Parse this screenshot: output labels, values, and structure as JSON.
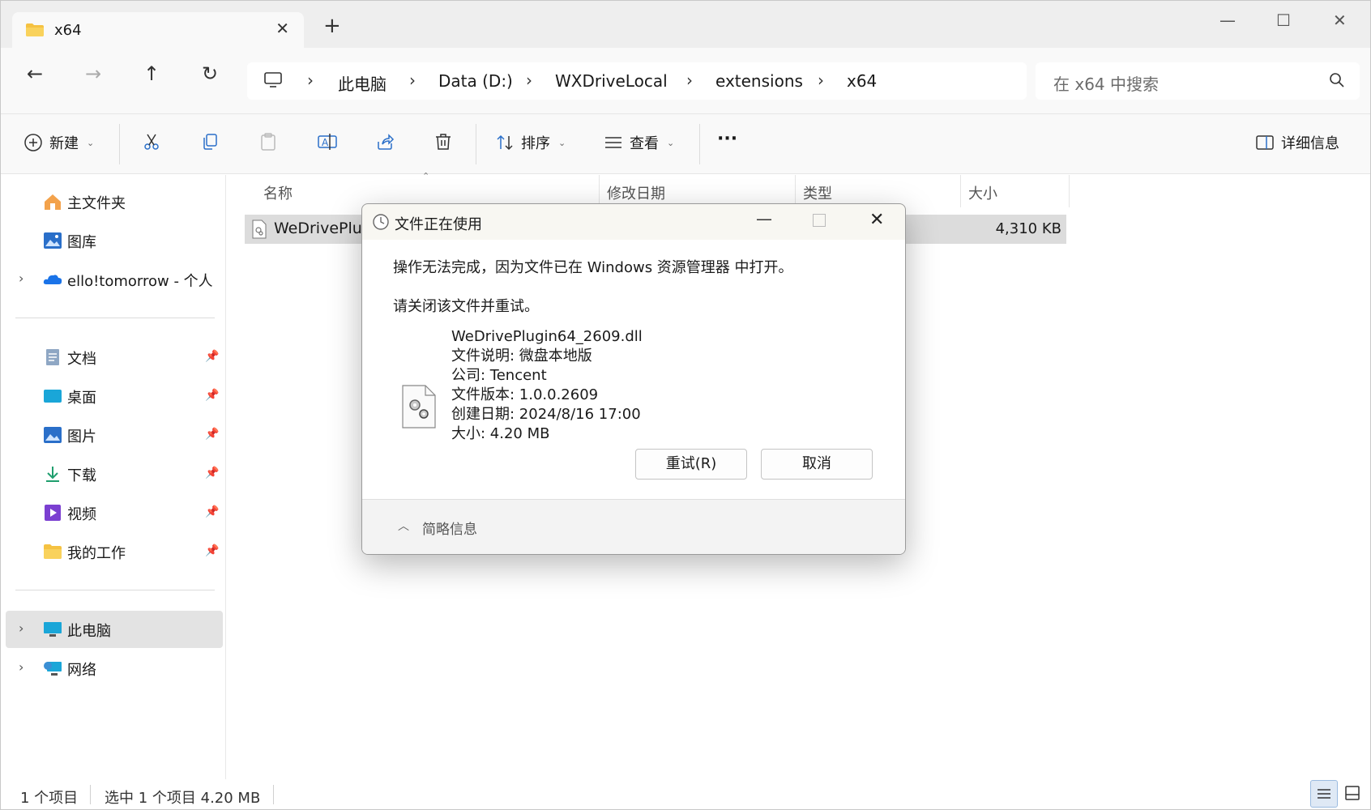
{
  "tab": {
    "title": "x64",
    "close": "✕",
    "new": "+"
  },
  "window_controls": {
    "minimize": "—",
    "maximize": "☐",
    "close": "✕"
  },
  "nav": {
    "back": "←",
    "forward": "→",
    "up": "↑",
    "refresh": "↻"
  },
  "breadcrumb": [
    "此电脑",
    "Data (D:)",
    "WXDriveLocal",
    "extensions",
    "x64"
  ],
  "search": {
    "placeholder": "在 x64 中搜索"
  },
  "toolbar": {
    "new_label": "新建",
    "sort_label": "排序",
    "view_label": "查看",
    "more_label": "···",
    "details_label": "详细信息"
  },
  "sidebar": {
    "items": [
      {
        "label": "主文件夹",
        "icon": "home-icon"
      },
      {
        "label": "图库",
        "icon": "gallery-icon"
      },
      {
        "label": "ello!tomorrow - 个人",
        "icon": "onedrive-icon"
      },
      {
        "label": "文档",
        "icon": "documents-icon"
      },
      {
        "label": "桌面",
        "icon": "desktop-icon"
      },
      {
        "label": "图片",
        "icon": "pictures-icon"
      },
      {
        "label": "下载",
        "icon": "downloads-icon"
      },
      {
        "label": "视频",
        "icon": "videos-icon"
      },
      {
        "label": "我的工作",
        "icon": "folder-icon"
      },
      {
        "label": "此电脑",
        "icon": "this-pc-icon"
      },
      {
        "label": "网络",
        "icon": "network-icon"
      }
    ]
  },
  "columns": {
    "name": "名称",
    "modified": "修改日期",
    "type": "类型",
    "size": "大小"
  },
  "files": [
    {
      "name": "WeDrivePlug",
      "size": "4,310 KB"
    }
  ],
  "status": {
    "count": "1 个项目",
    "selected": "选中 1 个项目  4.20 MB"
  },
  "dialog": {
    "title": "文件正在使用",
    "message": "操作无法完成，因为文件已在 Windows 资源管理器 中打开。",
    "instruction": "请关闭该文件并重试。",
    "details": [
      "WeDrivePlugin64_2609.dll",
      "文件说明: 微盘本地版",
      "公司: Tencent",
      "文件版本: 1.0.0.2609",
      "创建日期: 2024/8/16 17:00",
      "大小: 4.20 MB"
    ],
    "retry_label": "重试(R)",
    "cancel_label": "取消",
    "footer_label": "简略信息"
  },
  "colors": {
    "accent": "#0067c0",
    "selection": "#dcdcdc",
    "folder": "#f5c242"
  }
}
